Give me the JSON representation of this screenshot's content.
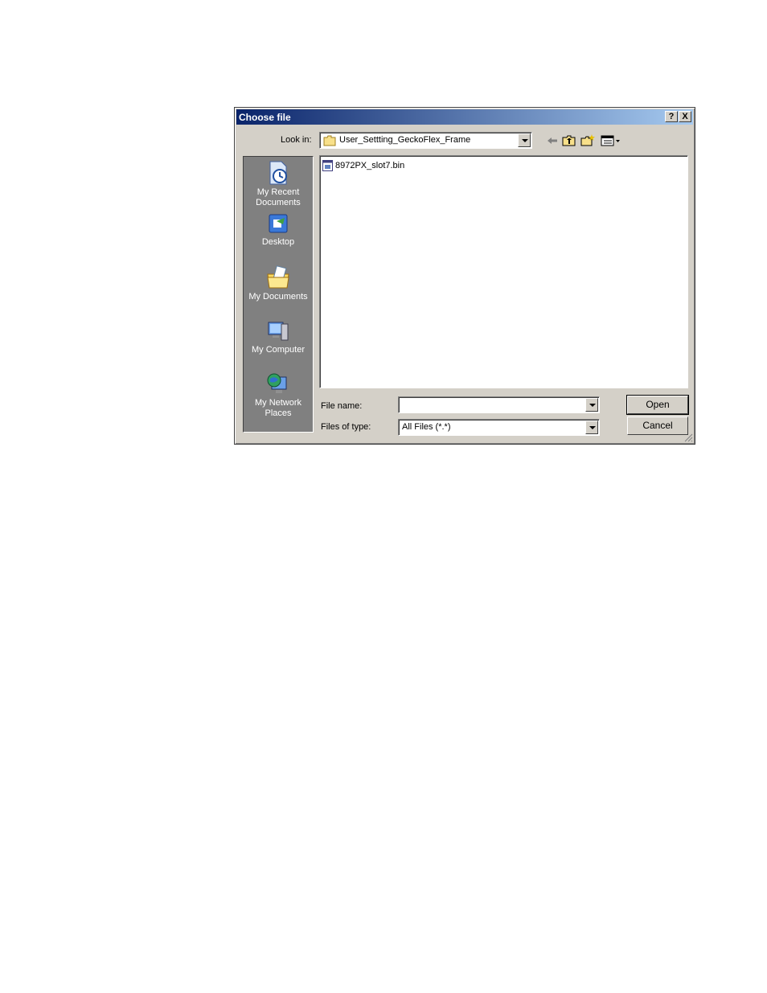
{
  "dialog": {
    "title": "Choose file",
    "help_label": "?",
    "close_label": "X"
  },
  "lookin": {
    "label": "Look in:",
    "value": "User_Settting_GeckoFlex_Frame"
  },
  "places": [
    {
      "label": "My Recent Documents",
      "icon": "recent-documents-icon"
    },
    {
      "label": "Desktop",
      "icon": "desktop-icon"
    },
    {
      "label": "My Documents",
      "icon": "my-documents-icon"
    },
    {
      "label": "My Computer",
      "icon": "my-computer-icon"
    },
    {
      "label": "My Network Places",
      "icon": "network-places-icon"
    }
  ],
  "files": [
    {
      "name": "8972PX_slot7.bin",
      "icon": "binary-file-icon"
    }
  ],
  "filename": {
    "label": "File name:",
    "value": ""
  },
  "filetype": {
    "label": "Files of type:",
    "value": "All Files (*.*)"
  },
  "buttons": {
    "open_label": "Open",
    "cancel_label": "Cancel"
  },
  "colors": {
    "titlebar_start": "#0a246a",
    "titlebar_end": "#a6caf0",
    "face": "#d4d0c8",
    "places_bg": "#808080"
  }
}
